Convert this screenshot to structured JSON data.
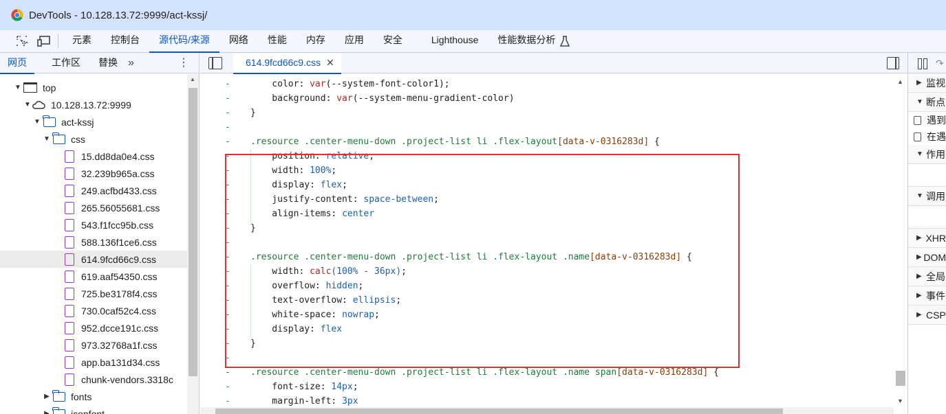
{
  "window": {
    "title": "DevTools - 10.128.13.72:9999/act-kssj/"
  },
  "main_tabs": [
    {
      "label": "元素"
    },
    {
      "label": "控制台"
    },
    {
      "label": "源代码/来源"
    },
    {
      "label": "网络"
    },
    {
      "label": "性能"
    },
    {
      "label": "内存"
    },
    {
      "label": "应用"
    },
    {
      "label": "安全"
    },
    {
      "label": "Lighthouse"
    },
    {
      "label": "性能数据分析"
    }
  ],
  "left_panel": {
    "tabs": [
      {
        "label": "网页"
      },
      {
        "label": "工作区"
      },
      {
        "label": "替换"
      }
    ],
    "more": "»",
    "tree": {
      "top": "top",
      "host": "10.128.13.72:9999",
      "app": "act-kssj",
      "css_folder": "css",
      "files": [
        "15.dd8da0e4.css",
        "32.239b965a.css",
        "249.acfbd433.css",
        "265.56055681.css",
        "543.f1fcc95b.css",
        "588.136f1ce6.css",
        "614.9fcd66c9.css",
        "619.aaf54350.css",
        "725.be3178f4.css",
        "730.0caf52c4.css",
        "952.dcce191c.css",
        "973.32768a1f.css",
        "app.ba131d34.css",
        "chunk-vendors.3318c"
      ],
      "selected_index": 6,
      "folders_after": [
        "fonts",
        "iconfont"
      ]
    }
  },
  "editor": {
    "tab_label": "614.9fcd66c9.css",
    "lines": [
      {
        "g": "-",
        "t": [
          [
            "prop",
            "    color: "
          ],
          [
            "kw",
            "var"
          ],
          [
            "prop",
            "(--system-font-color1);"
          ]
        ]
      },
      {
        "g": "-",
        "t": [
          [
            "prop",
            "    background: "
          ],
          [
            "kw",
            "var"
          ],
          [
            "prop",
            "(--system-menu-gradient-color)"
          ]
        ]
      },
      {
        "g": "-",
        "t": [
          [
            "prop",
            "}"
          ]
        ]
      },
      {
        "g": "-",
        "t": []
      },
      {
        "g": "-",
        "t": [
          [
            "sel",
            ".resource .center-menu-down .project-list li .flex-layout"
          ],
          [
            "attr",
            "[data-v-0316283d]"
          ],
          [
            "prop",
            " {"
          ]
        ]
      },
      {
        "g": "-",
        "t": [
          [
            "prop",
            "    position: "
          ],
          [
            "val",
            "relative"
          ],
          [
            "prop",
            ";"
          ]
        ]
      },
      {
        "g": "-",
        "t": [
          [
            "prop",
            "    width: "
          ],
          [
            "num",
            "100%"
          ],
          [
            "prop",
            ";"
          ]
        ]
      },
      {
        "g": "-",
        "t": [
          [
            "prop",
            "    display: "
          ],
          [
            "val",
            "flex"
          ],
          [
            "prop",
            ";"
          ]
        ]
      },
      {
        "g": "-",
        "t": [
          [
            "prop",
            "    justify-content: "
          ],
          [
            "val",
            "space-between"
          ],
          [
            "prop",
            ";"
          ]
        ]
      },
      {
        "g": "-",
        "t": [
          [
            "prop",
            "    align-items: "
          ],
          [
            "val",
            "center"
          ]
        ]
      },
      {
        "g": "-",
        "t": [
          [
            "prop",
            "}"
          ]
        ]
      },
      {
        "g": "-",
        "t": []
      },
      {
        "g": "-",
        "t": [
          [
            "sel",
            ".resource .center-menu-down .project-list li .flex-layout .name"
          ],
          [
            "attr",
            "[data-v-0316283d]"
          ],
          [
            "prop",
            " {"
          ]
        ]
      },
      {
        "g": "-",
        "t": [
          [
            "prop",
            "    width: "
          ],
          [
            "kw",
            "calc"
          ],
          [
            "num",
            "(100% - 36px)"
          ],
          [
            "prop",
            ";"
          ]
        ]
      },
      {
        "g": "-",
        "t": [
          [
            "prop",
            "    overflow: "
          ],
          [
            "val",
            "hidden"
          ],
          [
            "prop",
            ";"
          ]
        ]
      },
      {
        "g": "-",
        "t": [
          [
            "prop",
            "    text-overflow: "
          ],
          [
            "val",
            "ellipsis"
          ],
          [
            "prop",
            ";"
          ]
        ]
      },
      {
        "g": "-",
        "t": [
          [
            "prop",
            "    white-space: "
          ],
          [
            "val",
            "nowrap"
          ],
          [
            "prop",
            ";"
          ]
        ]
      },
      {
        "g": "-",
        "t": [
          [
            "prop",
            "    display: "
          ],
          [
            "val",
            "flex"
          ]
        ]
      },
      {
        "g": "-",
        "t": [
          [
            "prop",
            "}"
          ]
        ]
      },
      {
        "g": "-",
        "t": []
      },
      {
        "g": "-",
        "t": [
          [
            "sel",
            ".resource .center-menu-down .project-list li .flex-layout .name span"
          ],
          [
            "attr",
            "[data-v-0316283d]"
          ],
          [
            "prop",
            " {"
          ]
        ]
      },
      {
        "g": "-",
        "t": [
          [
            "prop",
            "    font-size: "
          ],
          [
            "num",
            "14px"
          ],
          [
            "prop",
            ";"
          ]
        ]
      },
      {
        "g": "-",
        "t": [
          [
            "prop",
            "    margin-left: "
          ],
          [
            "num",
            "3px"
          ]
        ]
      }
    ]
  },
  "right_panel": {
    "sections": [
      {
        "label": "监视",
        "expanded": false
      },
      {
        "label": "断点",
        "expanded": true
      }
    ],
    "checks": [
      {
        "label": "遇到"
      },
      {
        "label": "在遇"
      }
    ],
    "sections2": [
      {
        "label": "作用",
        "expanded": true
      },
      {
        "label": "调用",
        "expanded": true
      }
    ],
    "sections3": [
      {
        "label": "XHR"
      },
      {
        "label": "DOM"
      },
      {
        "label": "全局"
      },
      {
        "label": "事件"
      },
      {
        "label": "CSP"
      }
    ]
  },
  "colors": {
    "accent": "#0b57d0",
    "highlight_box": "#e0302d",
    "titlebar": "#d3e3fd"
  }
}
